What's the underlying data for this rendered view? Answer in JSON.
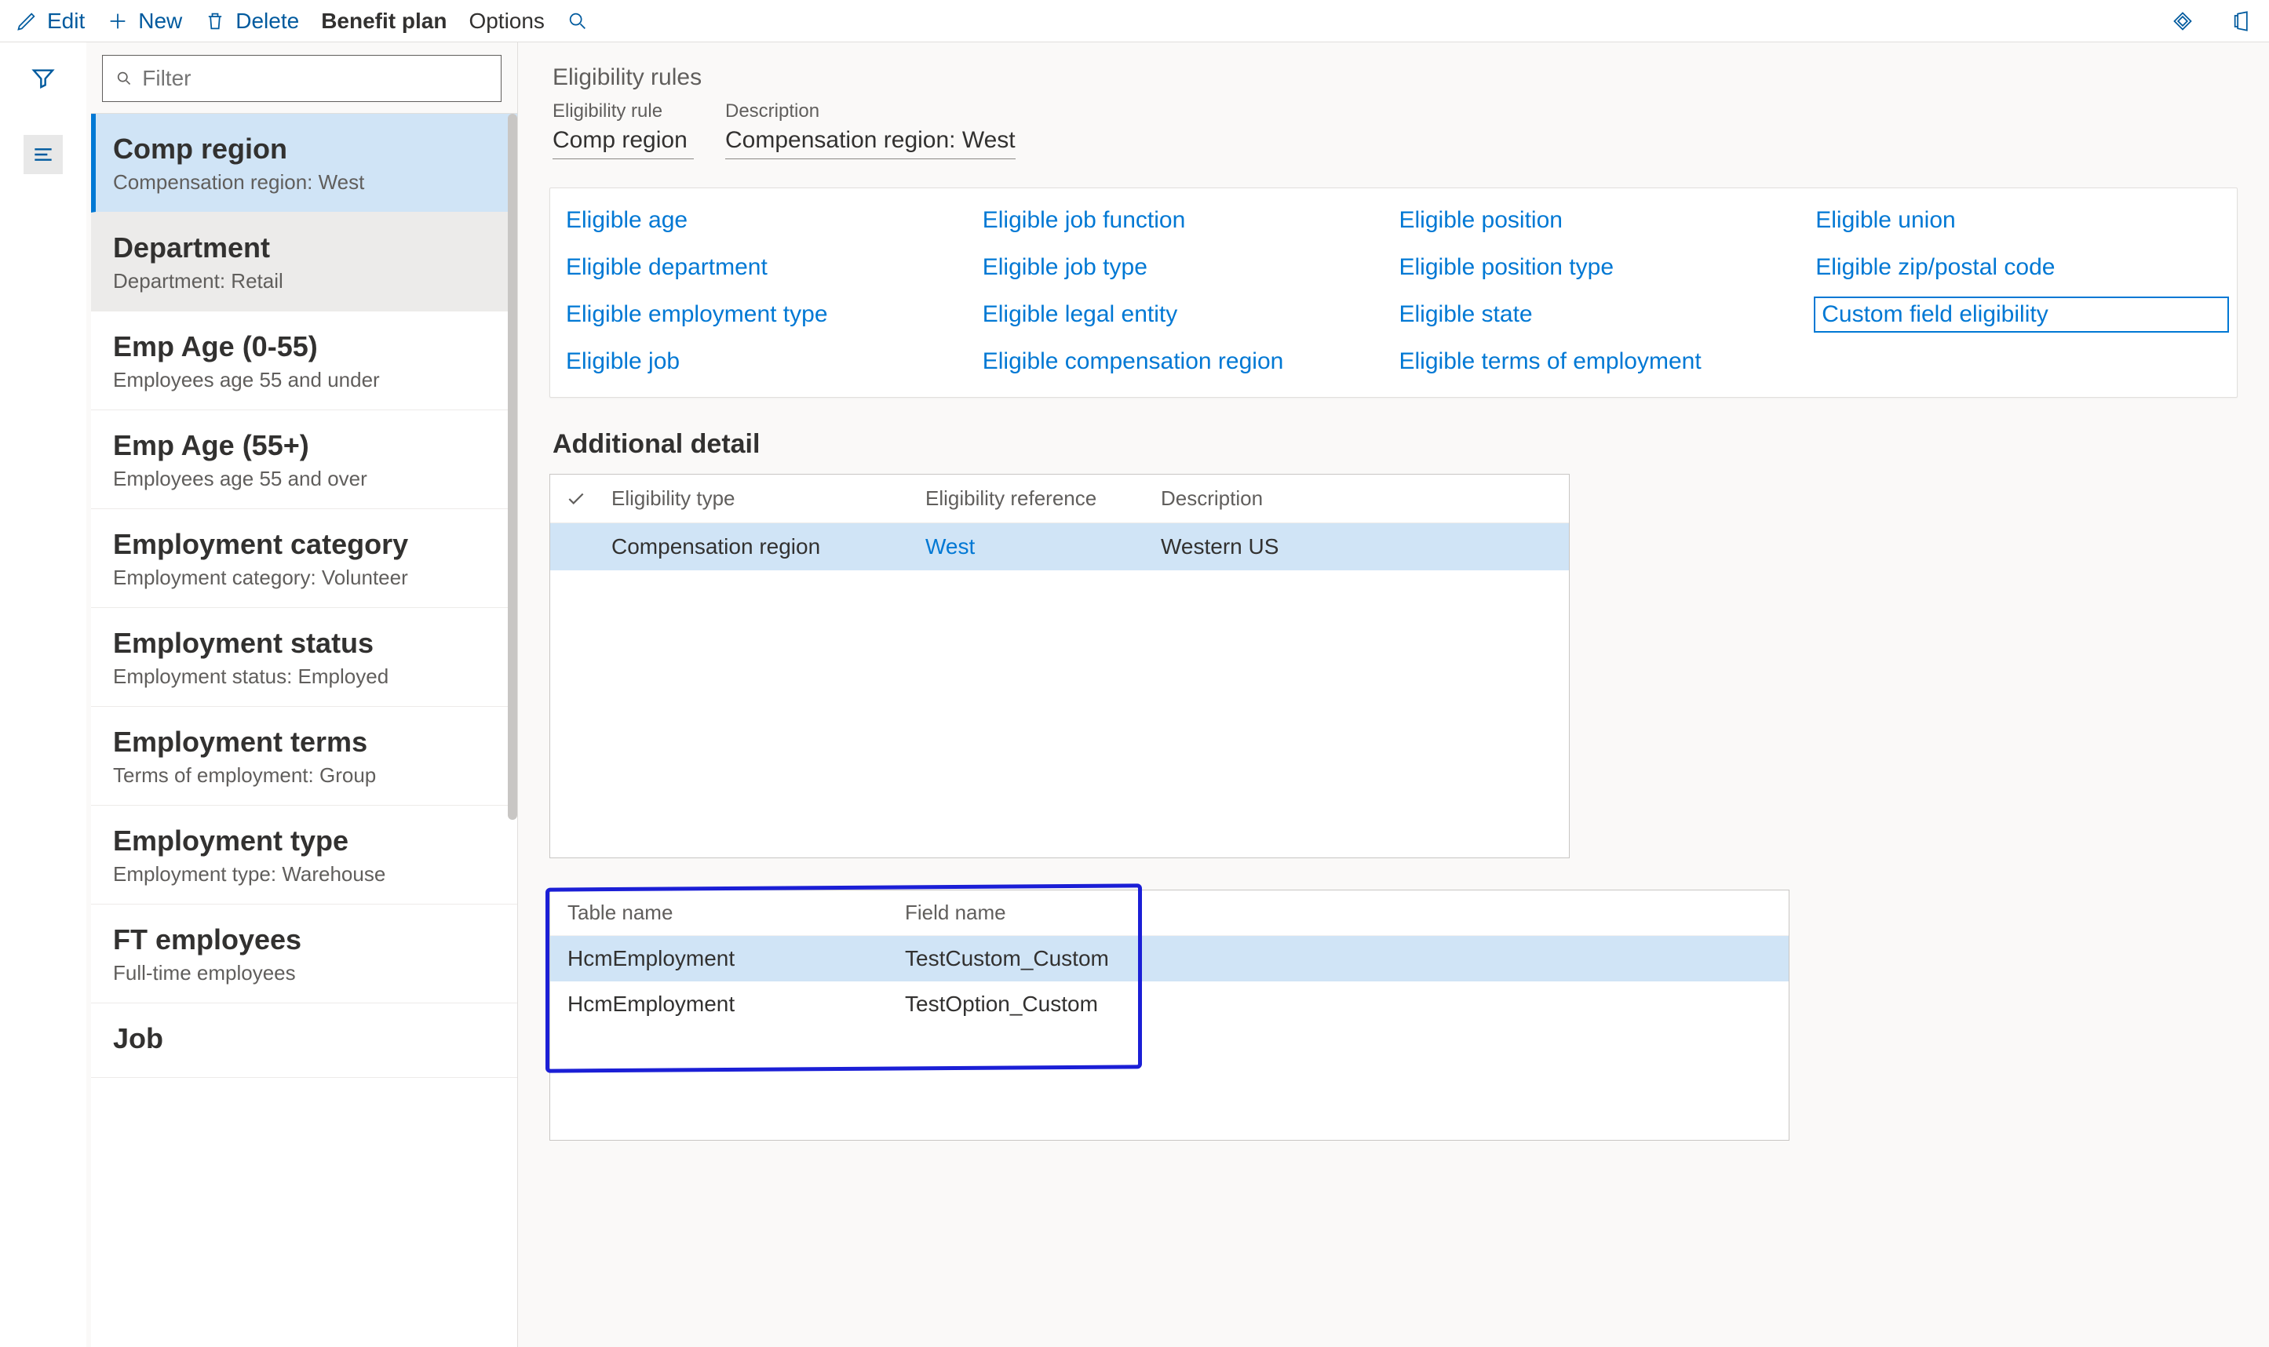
{
  "toolbar": {
    "edit": "Edit",
    "new": "New",
    "delete": "Delete",
    "benefit_plan": "Benefit plan",
    "options": "Options"
  },
  "filter_placeholder": "Filter",
  "nav_items": [
    {
      "title": "Comp region",
      "desc": "Compensation region:  West"
    },
    {
      "title": "Department",
      "desc": "Department:  Retail"
    },
    {
      "title": "Emp Age (0-55)",
      "desc": "Employees age 55 and under"
    },
    {
      "title": "Emp Age (55+)",
      "desc": "Employees age 55 and over"
    },
    {
      "title": "Employment category",
      "desc": "Employment category:  Volunteer"
    },
    {
      "title": "Employment status",
      "desc": "Employment status: Employed"
    },
    {
      "title": "Employment terms",
      "desc": "Terms of employment: Group"
    },
    {
      "title": "Employment type",
      "desc": "Employment type: Warehouse"
    },
    {
      "title": "FT employees",
      "desc": "Full-time employees"
    },
    {
      "title": "Job",
      "desc": ""
    }
  ],
  "page_title": "Eligibility rules",
  "rule_header": {
    "rule_label": "Eligibility rule",
    "rule_value": "Comp region",
    "desc_label": "Description",
    "desc_value": "Compensation region:  West"
  },
  "eligible_links": [
    "Eligible age",
    "Eligible job function",
    "Eligible position",
    "Eligible union",
    "Eligible department",
    "Eligible job type",
    "Eligible position type",
    "Eligible zip/postal code",
    "Eligible employment type",
    "Eligible legal entity",
    "Eligible state",
    "Custom field eligibility",
    "Eligible job",
    "Eligible compensation region",
    "Eligible terms of employment"
  ],
  "eligible_boxed_index": 11,
  "additional_detail_title": "Additional detail",
  "detail_grid": {
    "headers": {
      "c1": "Eligibility type",
      "c2": "Eligibility reference",
      "c3": "Description"
    },
    "rows": [
      {
        "c1": "Compensation region",
        "c2": "West",
        "c3": "Western US"
      }
    ]
  },
  "custom_grid": {
    "headers": {
      "c1": "Table name",
      "c2": "Field name"
    },
    "rows": [
      {
        "c1": "HcmEmployment",
        "c2": "TestCustom_Custom",
        "selected": true
      },
      {
        "c1": "HcmEmployment",
        "c2": "TestOption_Custom",
        "selected": false
      }
    ]
  }
}
